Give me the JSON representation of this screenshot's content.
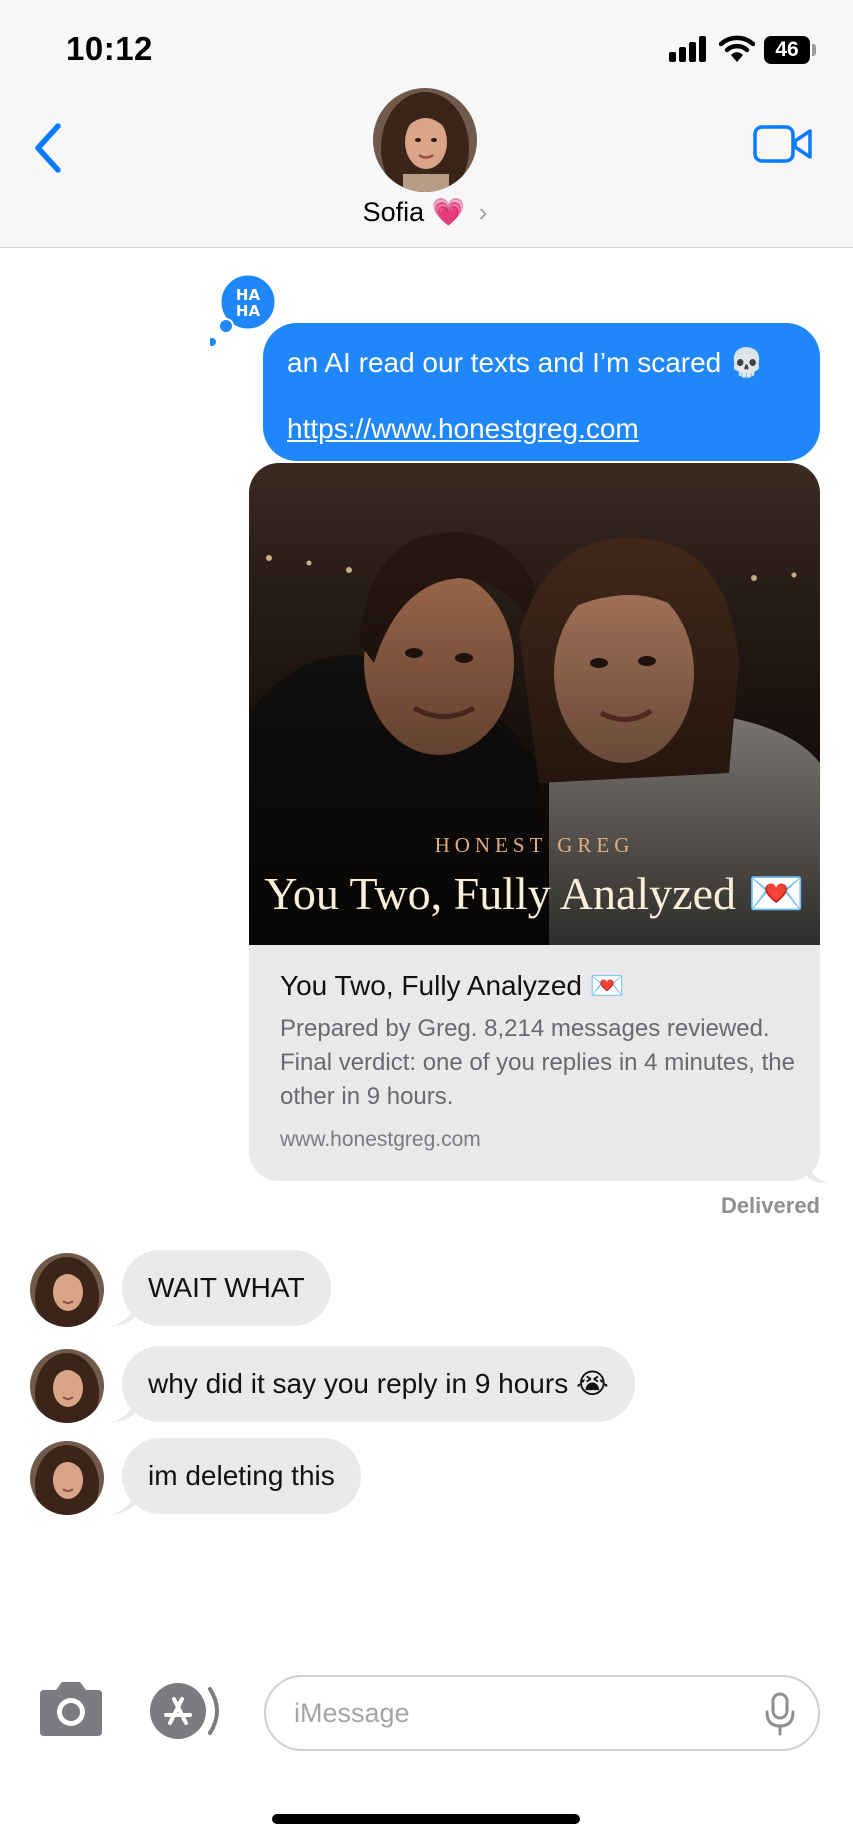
{
  "status_bar": {
    "time": "10:12",
    "battery": "46"
  },
  "header": {
    "contact_name": "Sofia",
    "contact_emoji": "💗",
    "chevron": "›"
  },
  "messages": {
    "outgoing": {
      "text": "an AI read our texts and I’m scared 💀",
      "link": "https://www.honestgreg.com",
      "tapback": "HA HA"
    },
    "link_preview": {
      "brand": "HONEST GREG",
      "headline": "You Two, Fully Analyzed 💌",
      "title": "You Two, Fully Analyzed 💌",
      "description": "Prepared by Greg. 8,214 messages reviewed. Final verdict: one of you replies in 4 minutes, the other in 9 hours.",
      "url": "www.honestgreg.com"
    },
    "status": "Delivered",
    "incoming": [
      {
        "text": "WAIT WHAT"
      },
      {
        "text": "why did it say you reply in 9 hours 😭"
      },
      {
        "text": "im deleting this"
      }
    ]
  },
  "composer": {
    "placeholder": "iMessage"
  },
  "colors": {
    "imessage_blue": "#1f87fa",
    "incoming_gray": "#e9e9eb",
    "ios_blue": "#0a7aff"
  },
  "icons": {
    "back": "chevron-left-icon",
    "video": "video-camera-icon",
    "camera": "camera-icon",
    "apps": "app-store-icon",
    "mic": "microphone-icon"
  }
}
